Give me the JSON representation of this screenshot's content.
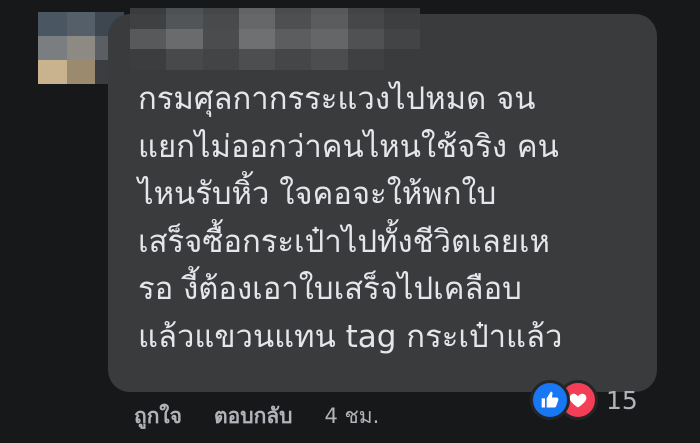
{
  "comment": {
    "lines": [
      "กรมศุลกากรระแวงไปหมด จน",
      "แยกไม่ออกว่าคนไหนใช้จริง คน",
      "ไหนรับหิ้ว ใจคอจะให้พกใบ",
      "เสร็จซื้อกระเป๋าไปทั้งชีวิตเลยเห",
      "รอ งี้ต้องเอาใบเสร็จไปเคลือบ",
      "แล้วแขวนแทน tag กระเป๋าแล้ว"
    ]
  },
  "reactions": {
    "icons": [
      "like-icon",
      "love-icon"
    ],
    "count": "15",
    "colors": {
      "like": "#1877f2",
      "love": "#f33e58"
    }
  },
  "actions": {
    "like_label": "ถูกใจ",
    "reply_label": "ตอบกลับ",
    "timestamp": "4 ชม."
  },
  "theme": {
    "page_bg": "#17181a",
    "bubble_bg": "#3a3b3c",
    "text_color": "#e4e6eb",
    "meta_color": "#b0b3b8"
  }
}
